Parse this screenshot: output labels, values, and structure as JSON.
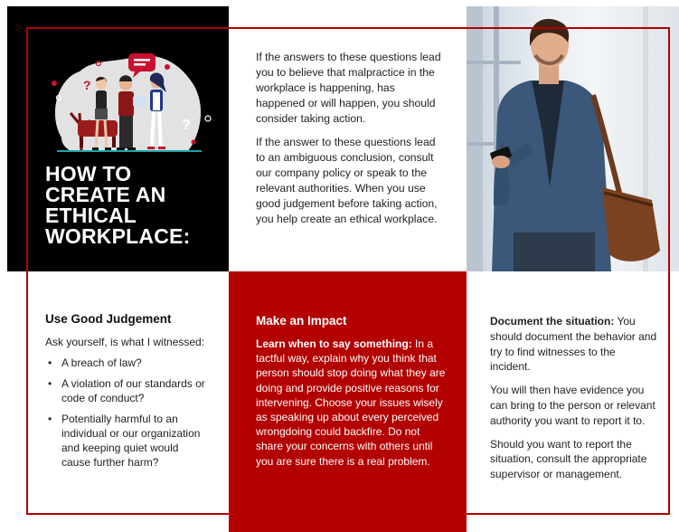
{
  "headline": [
    "HOW TO",
    "CREATE AN",
    "ETHICAL",
    "WORKPLACE:"
  ],
  "top_paragraphs": [
    "If the answers to these questions lead you to believe that malpractice in the workplace is happening, has happened or will happen, you should consider taking action.",
    "If the answer to these questions lead to an ambiguous conclusion, consult our company policy or speak to the relevant authorities. When you use good judgement before taking action, you help create an ethical workplace."
  ],
  "judgement": {
    "title": "Use Good Judgement",
    "intro": "Ask yourself, is what I witnessed:",
    "bullets": [
      "A breach of law?",
      "A violation of our standards or code of conduct?",
      "Potentially harmful to an individual or our organization and keeping quiet would cause further harm?"
    ],
    "bullet_glyph": "•"
  },
  "impact": {
    "title": "Make an Impact",
    "lead": "Learn when to say something:",
    "body": " In a tactful way, explain why you think that person should stop doing what they are doing and provide positive reasons for intervening. Choose your issues wisely as speaking up about every perceived wrongdoing could backfire. Do not share your concerns with others until you are sure there is a real problem."
  },
  "document": {
    "lead": "Document the situation:",
    "body": " You should document the behavior and try to find witnesses to the incident.",
    "paragraphs": [
      "You will then have evidence you can bring to the person or relevant authority you want to report it to.",
      "Should you want to report the situation, consult the appropriate supervisor or management."
    ]
  },
  "illustration": {
    "bubble_mark": "?"
  },
  "colors": {
    "brand_red": "#b30000",
    "black": "#000000"
  }
}
